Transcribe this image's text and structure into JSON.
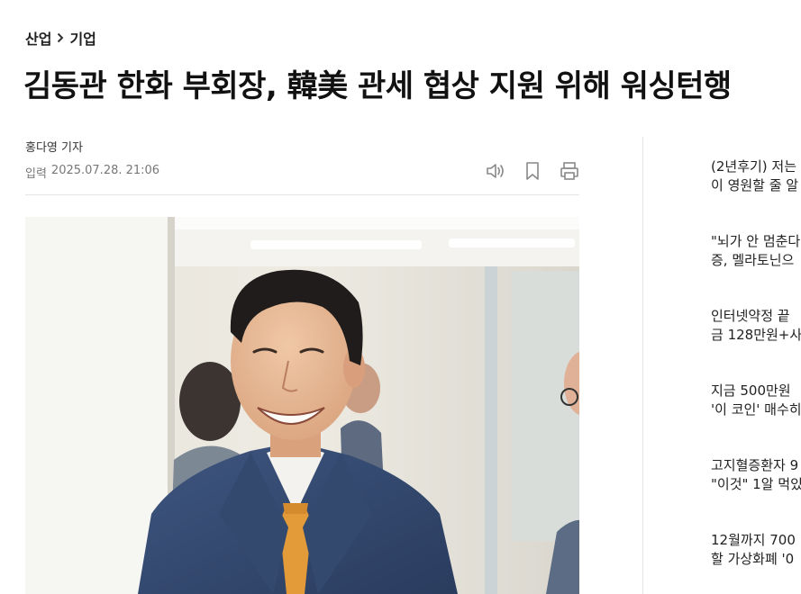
{
  "breadcrumb": {
    "section": "산업",
    "subsection": "기업"
  },
  "article": {
    "headline": "김동관 한화 부회장, 韓美 관세 협상 지원 위해 워싱턴행",
    "reporter": "홍다영 기자",
    "date_label": "입력",
    "date_value": "2025.07.28. 21:06"
  },
  "tools": {
    "icons": [
      "speaker-icon",
      "bookmark-icon",
      "print-icon"
    ]
  },
  "photo": {
    "subject": "smiling man in blue suit with orange tie"
  },
  "sidebar": {
    "items": [
      {
        "line1": "(2년후기) 저는",
        "line2": "이 영원할 줄 알"
      },
      {
        "line1": "\"뇌가 안 멈춘다",
        "line2": "증, 멜라토닌으"
      },
      {
        "line1": "인터넷약정 끝",
        "line2": "금 128만원+사"
      },
      {
        "line1": "지금 500만원",
        "line2": "'이 코인' 매수히"
      },
      {
        "line1": "고지혈증환자 9",
        "line2": "\"이것\" 1알 먹있"
      },
      {
        "line1": "12월까지 700",
        "line2": "할 가상화폐 '0"
      }
    ]
  },
  "colors": {
    "text_primary": "#111111",
    "text_meta": "#777777",
    "divider": "#e4e4e4",
    "icon": "#888888"
  }
}
